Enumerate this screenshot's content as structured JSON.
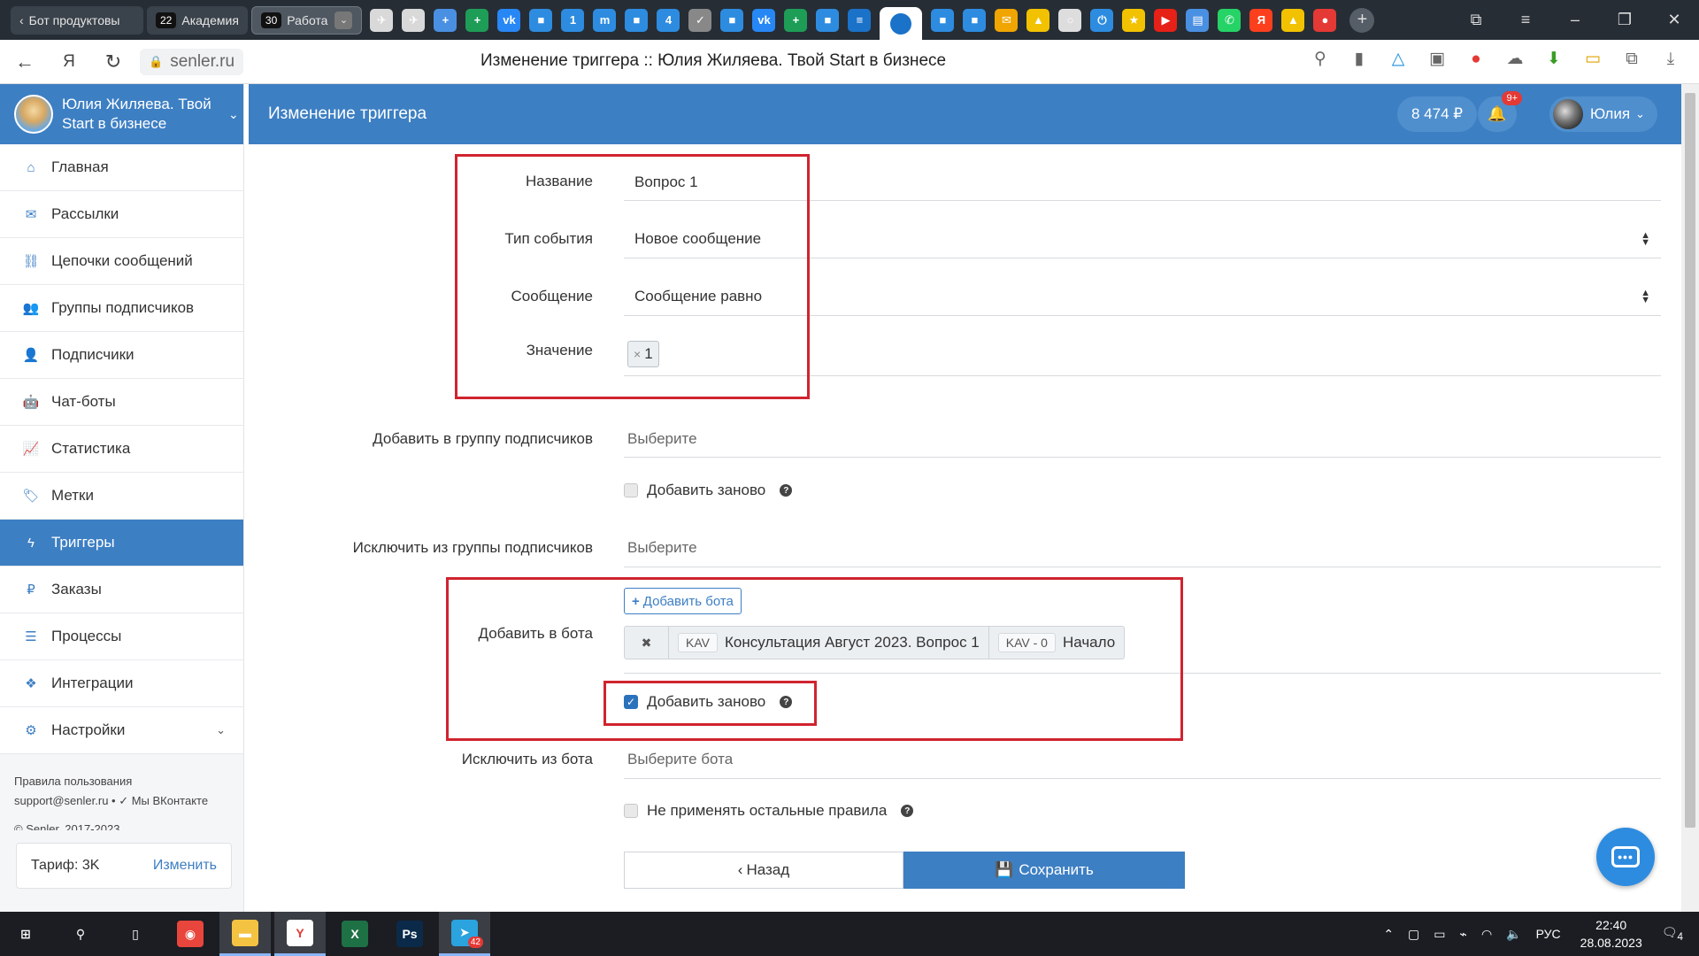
{
  "browser": {
    "tabs": {
      "first_tab_label": "Бот продуктовы",
      "group1": {
        "count": "22",
        "label": "Академия"
      },
      "group2": {
        "count": "30",
        "label": "Работа"
      }
    },
    "favicons": [
      {
        "name": "airplane-icon",
        "glyph": "✈",
        "color": "#d9d9d9"
      },
      {
        "name": "airplane-icon",
        "glyph": "✈",
        "color": "#d9d9d9"
      },
      {
        "name": "google-docs-plus-icon",
        "glyph": "+",
        "color": "#4a90e2"
      },
      {
        "name": "google-sheets-plus-icon",
        "glyph": "+",
        "color": "#1e9d57"
      },
      {
        "name": "vk-icon",
        "glyph": "vk",
        "color": "#2787f5"
      },
      {
        "name": "chat-icon",
        "glyph": "■",
        "color": "#2d8ce0"
      },
      {
        "name": "number-1-icon",
        "glyph": "1",
        "color": "#2d8ce0"
      },
      {
        "name": "m-icon",
        "glyph": "m",
        "color": "#2d8ce0"
      },
      {
        "name": "chat-icon",
        "glyph": "■",
        "color": "#2d8ce0"
      },
      {
        "name": "number-4-icon",
        "glyph": "4",
        "color": "#2d8ce0"
      },
      {
        "name": "checklist-icon",
        "glyph": "✓",
        "color": "#888888"
      },
      {
        "name": "chat-icon",
        "glyph": "■",
        "color": "#2d8ce0"
      },
      {
        "name": "vk-icon",
        "glyph": "vk",
        "color": "#2787f5"
      },
      {
        "name": "google-sheets-plus-icon",
        "glyph": "+",
        "color": "#1e9d57"
      },
      {
        "name": "chat-icon",
        "glyph": "■",
        "color": "#2d8ce0"
      },
      {
        "name": "senler-icon",
        "glyph": "≡",
        "color": "#1a72c9"
      },
      {
        "name": "chat-icon",
        "glyph": "■",
        "color": "#2d8ce0"
      },
      {
        "name": "chat-icon",
        "glyph": "■",
        "color": "#2d8ce0"
      },
      {
        "name": "mail-icon",
        "glyph": "✉",
        "color": "#f0a500"
      },
      {
        "name": "image-icon",
        "glyph": "▲",
        "color": "#f2c200"
      },
      {
        "name": "circle-icon",
        "glyph": "○",
        "color": "#dddddd"
      },
      {
        "name": "power-icon",
        "glyph": "⏻",
        "color": "#2d8ce0"
      },
      {
        "name": "star-icon",
        "glyph": "★",
        "color": "#f2c200"
      },
      {
        "name": "youtube-icon",
        "glyph": "▶",
        "color": "#e62117"
      },
      {
        "name": "document-icon",
        "glyph": "▤",
        "color": "#4a90e2"
      },
      {
        "name": "whatsapp-icon",
        "glyph": "✆",
        "color": "#25d366"
      },
      {
        "name": "yandex-icon",
        "glyph": "Я",
        "color": "#fc3f1d"
      },
      {
        "name": "image-icon",
        "glyph": "▲",
        "color": "#f2c200"
      },
      {
        "name": "record-icon",
        "glyph": "●",
        "color": "#e53935"
      }
    ],
    "url": "senler.ru",
    "page_title": "Изменение триггера :: Юлия Жиляева. Твой Start в бизнесе"
  },
  "sidebar": {
    "community_name": "Юлия Жиляева. Твой Start в бизнесе",
    "items": [
      {
        "label": "Главная",
        "icon": "home-icon",
        "glyph": "⌂",
        "active": false
      },
      {
        "label": "Рассылки",
        "icon": "envelope-icon",
        "glyph": "✉",
        "active": false
      },
      {
        "label": "Цепочки сообщений",
        "icon": "chain-icon",
        "glyph": "⛓",
        "active": false
      },
      {
        "label": "Группы подписчиков",
        "icon": "users-icon",
        "glyph": "👥",
        "active": false
      },
      {
        "label": "Подписчики",
        "icon": "user-icon",
        "glyph": "👤",
        "active": false
      },
      {
        "label": "Чат-боты",
        "icon": "android-icon",
        "glyph": "🤖",
        "active": false
      },
      {
        "label": "Статистика",
        "icon": "line-chart-icon",
        "glyph": "📈",
        "active": false
      },
      {
        "label": "Метки",
        "icon": "tag-icon",
        "glyph": "🏷",
        "active": false
      },
      {
        "label": "Триггеры",
        "icon": "bolt-icon",
        "glyph": "ϟ",
        "active": true
      },
      {
        "label": "Заказы",
        "icon": "ruble-icon",
        "glyph": "₽",
        "active": false
      },
      {
        "label": "Процессы",
        "icon": "list-icon",
        "glyph": "☰",
        "active": false
      },
      {
        "label": "Интеграции",
        "icon": "cubes-icon",
        "glyph": "❖",
        "active": false
      },
      {
        "label": "Настройки",
        "icon": "cogs-icon",
        "glyph": "⚙",
        "active": false,
        "has_submenu": true
      }
    ],
    "footer": {
      "terms": "Правила пользования",
      "support": "support@senler.ru",
      "vk": "• ✓ Мы ВКонтакте",
      "copyright": "© Senler, 2017-2023"
    },
    "tariff": {
      "label": "Тариф: 3K",
      "change": "Изменить"
    }
  },
  "header": {
    "title": "Изменение триггера",
    "balance": "8 474 ₽",
    "notifications": "9+",
    "user": "Юлия"
  },
  "form": {
    "name_label": "Название",
    "name_value": "Вопрос 1",
    "event_type_label": "Тип события",
    "event_type_value": "Новое сообщение",
    "message_label": "Сообщение",
    "message_value": "Сообщение равно",
    "value_label": "Значение",
    "value_tag": "1",
    "add_group_label": "Добавить в группу подписчиков",
    "add_group_placeholder": "Выберите",
    "add_again_1": "Добавить заново",
    "exclude_group_label": "Исключить из группы подписчиков",
    "exclude_group_placeholder": "Выберите",
    "add_bot_label": "Добавить в бота",
    "add_bot_button": "Добавить бота",
    "bot_row": {
      "bot_tag": "KAV",
      "bot_name": "Консультация Август 2023. Вопрос 1",
      "step_tag": "KAV - 0",
      "step_name": "Начало"
    },
    "add_again_2": "Добавить заново",
    "exclude_bot_label": "Исключить из бота",
    "exclude_bot_placeholder": "Выберите бота",
    "no_other_rules": "Не применять остальные правила",
    "back_button": "Назад",
    "save_button": "Сохранить"
  },
  "taskbar": {
    "items": [
      {
        "name": "windows-start-icon",
        "glyph": "⊞",
        "bg": "transparent"
      },
      {
        "name": "search-icon",
        "glyph": "⚲",
        "bg": "transparent"
      },
      {
        "name": "task-view-icon",
        "glyph": "▯",
        "bg": "transparent"
      },
      {
        "name": "chrome-icon",
        "glyph": "◉",
        "bg": "#e8453c"
      },
      {
        "name": "file-explorer-icon",
        "glyph": "▬",
        "bg": "#f5c342"
      },
      {
        "name": "yandex-browser-icon",
        "glyph": "Y",
        "bg": "#ffffff"
      },
      {
        "name": "excel-icon",
        "glyph": "X",
        "bg": "#1e7145"
      },
      {
        "name": "photoshop-icon",
        "glyph": "Ps",
        "bg": "#0b2a4a"
      },
      {
        "name": "telegram-icon",
        "glyph": "➤",
        "bg": "#2aa3df"
      }
    ],
    "telegram_badge": "42",
    "lang": "РУС",
    "time": "22:40",
    "date": "28.08.2023",
    "notif_count": "4"
  },
  "colors": {
    "brand": "#3d7fc3",
    "highlight": "#d0242f"
  }
}
